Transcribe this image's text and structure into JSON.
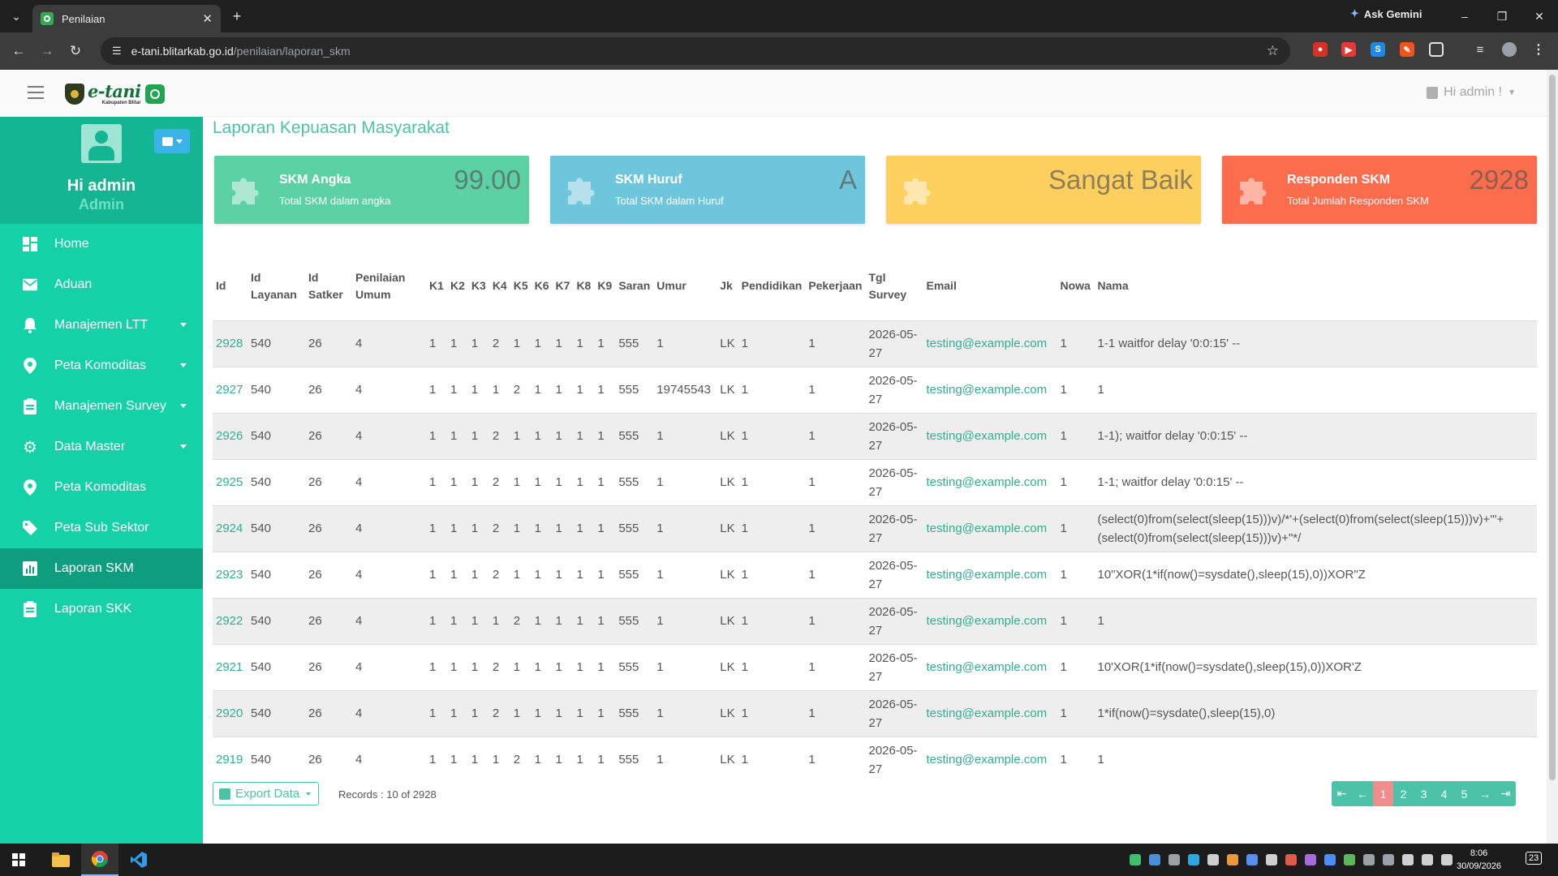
{
  "browser": {
    "tab_title": "Penilaian",
    "ask_gemini": "Ask Gemini",
    "url_host": "e-tani.blitarkab.go.id",
    "url_path": "/penilaian/laporan_skm"
  },
  "header": {
    "logo_name": "e-tani",
    "logo_sub": "Kabupaten Blitar",
    "user_menu": "Hi admin !"
  },
  "sidebar": {
    "profile_name": "Hi admin",
    "profile_role": "Admin",
    "items": [
      {
        "label": "Home",
        "icon": "dashboard-icon"
      },
      {
        "label": "Aduan",
        "icon": "envelope-icon"
      },
      {
        "label": "Manajemen LTT",
        "icon": "bell-icon"
      },
      {
        "label": "Peta Komoditas",
        "icon": "map-pin-icon"
      },
      {
        "label": "Manajemen Survey",
        "icon": "clipboard-icon"
      },
      {
        "label": "Data Master",
        "icon": "gear-icon"
      },
      {
        "label": "Peta Komoditas",
        "icon": "map-pin-icon"
      },
      {
        "label": "Peta Sub Sektor",
        "icon": "tag-icon"
      },
      {
        "label": "Laporan SKM",
        "icon": "bar-chart-icon"
      },
      {
        "label": "Laporan SKK",
        "icon": "clipboard-icon"
      }
    ]
  },
  "page": {
    "title": "Laporan Kepuasan Masyarakat"
  },
  "cards": [
    {
      "title": "SKM Angka",
      "subtitle": "Total SKM dalam angka",
      "value": "99.00",
      "color": "#5cd1a3"
    },
    {
      "title": "SKM Huruf",
      "subtitle": "Total SKM dalam Huruf",
      "value": "A",
      "color": "#6ec6dc"
    },
    {
      "title": "",
      "subtitle": "",
      "value": "Sangat Baik",
      "color": "#fccf5f"
    },
    {
      "title": "Responden SKM",
      "subtitle": "Total Jumlah Responden SKM",
      "value": "2928",
      "color": "#fb6d4d"
    }
  ],
  "table": {
    "headers": [
      "Id",
      "Id Layanan",
      "Id Satker",
      "Penilaian Umum",
      "K1",
      "K2",
      "K3",
      "K4",
      "K5",
      "K6",
      "K7",
      "K8",
      "K9",
      "Saran",
      "Umur",
      "Jk",
      "Pendidikan",
      "Pekerjaan",
      "Tgl Survey",
      "Email",
      "Nowa",
      "Nama"
    ],
    "rows": [
      [
        "2928",
        "540",
        "26",
        "4",
        "1",
        "1",
        "1",
        "2",
        "1",
        "1",
        "1",
        "1",
        "1",
        "555",
        "1",
        "LK",
        "1",
        "1",
        "2026-05-27",
        "testing@example.com",
        "1",
        "1-1 waitfor delay '0:0:15' --"
      ],
      [
        "2927",
        "540",
        "26",
        "4",
        "1",
        "1",
        "1",
        "1",
        "2",
        "1",
        "1",
        "1",
        "1",
        "555",
        "19745543",
        "LK",
        "1",
        "1",
        "2026-05-27",
        "testing@example.com",
        "1",
        "1"
      ],
      [
        "2926",
        "540",
        "26",
        "4",
        "1",
        "1",
        "1",
        "2",
        "1",
        "1",
        "1",
        "1",
        "1",
        "555",
        "1",
        "LK",
        "1",
        "1",
        "2026-05-27",
        "testing@example.com",
        "1",
        "1-1); waitfor delay '0:0:15' --"
      ],
      [
        "2925",
        "540",
        "26",
        "4",
        "1",
        "1",
        "1",
        "2",
        "1",
        "1",
        "1",
        "1",
        "1",
        "555",
        "1",
        "LK",
        "1",
        "1",
        "2026-05-27",
        "testing@example.com",
        "1",
        "1-1; waitfor delay '0:0:15' --"
      ],
      [
        "2924",
        "540",
        "26",
        "4",
        "1",
        "1",
        "1",
        "2",
        "1",
        "1",
        "1",
        "1",
        "1",
        "555",
        "1",
        "LK",
        "1",
        "1",
        "2026-05-27",
        "testing@example.com",
        "1",
        "(select(0)from(select(sleep(15)))v)/*'+(select(0)from(select(sleep(15)))v)+'\"+(select(0)from(select(sleep(15)))v)+\"*/"
      ],
      [
        "2923",
        "540",
        "26",
        "4",
        "1",
        "1",
        "1",
        "2",
        "1",
        "1",
        "1",
        "1",
        "1",
        "555",
        "1",
        "LK",
        "1",
        "1",
        "2026-05-27",
        "testing@example.com",
        "1",
        "10\"XOR(1*if(now()=sysdate(),sleep(15),0))XOR\"Z"
      ],
      [
        "2922",
        "540",
        "26",
        "4",
        "1",
        "1",
        "1",
        "1",
        "2",
        "1",
        "1",
        "1",
        "1",
        "555",
        "1",
        "LK",
        "1",
        "1",
        "2026-05-27",
        "testing@example.com",
        "1",
        "1"
      ],
      [
        "2921",
        "540",
        "26",
        "4",
        "1",
        "1",
        "1",
        "2",
        "1",
        "1",
        "1",
        "1",
        "1",
        "555",
        "1",
        "LK",
        "1",
        "1",
        "2026-05-27",
        "testing@example.com",
        "1",
        "10'XOR(1*if(now()=sysdate(),sleep(15),0))XOR'Z"
      ],
      [
        "2920",
        "540",
        "26",
        "4",
        "1",
        "1",
        "1",
        "2",
        "1",
        "1",
        "1",
        "1",
        "1",
        "555",
        "1",
        "LK",
        "1",
        "1",
        "2026-05-27",
        "testing@example.com",
        "1",
        "1*if(now()=sysdate(),sleep(15),0)"
      ],
      [
        "2919",
        "540",
        "26",
        "4",
        "1",
        "1",
        "1",
        "1",
        "2",
        "1",
        "1",
        "1",
        "1",
        "555",
        "1",
        "LK",
        "1",
        "1",
        "2026-05-27",
        "testing@example.com",
        "1",
        "1"
      ]
    ]
  },
  "footer": {
    "export_label": "Export Data",
    "records": "Records : 10 of 2928",
    "pages": [
      "1",
      "2",
      "3",
      "4",
      "5"
    ],
    "active_page": "1"
  },
  "taskbar": {
    "time": "8:06",
    "date": "30/09/2026",
    "notifications": "23"
  }
}
